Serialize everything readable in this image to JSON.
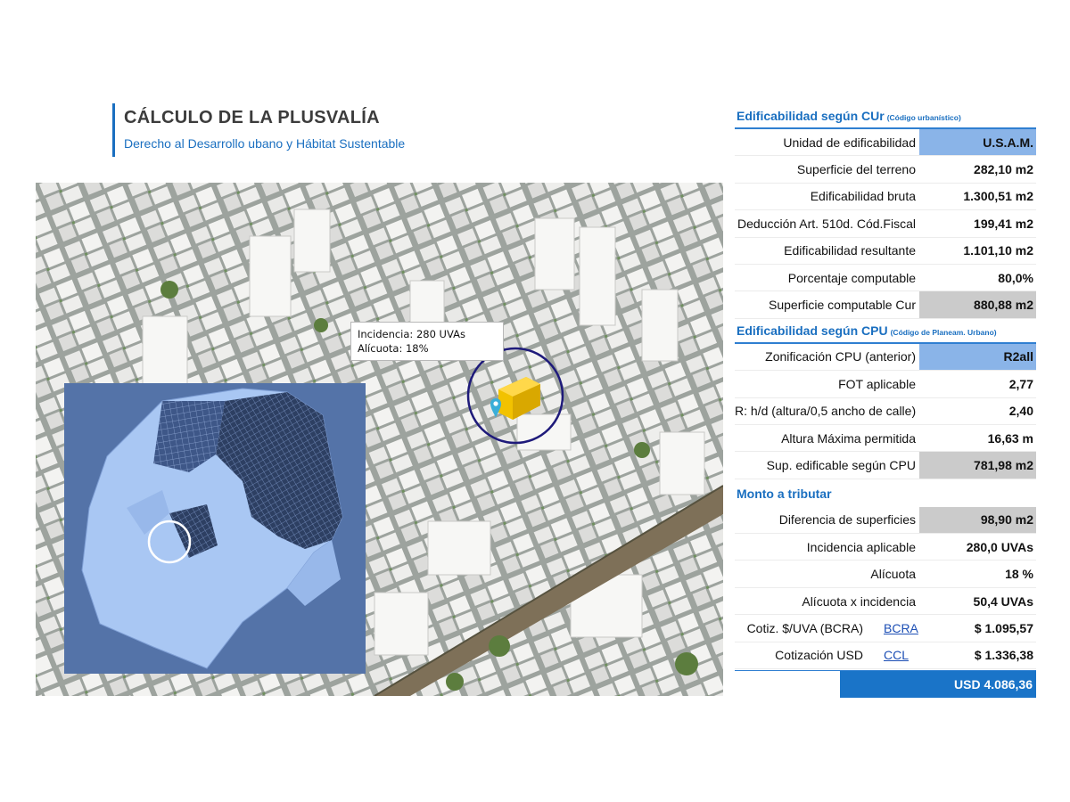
{
  "header": {
    "title": "CÁLCULO DE LA PLUSVALÍA",
    "subtitle": "Derecho al Desarrollo ubano y Hábitat Sustentable"
  },
  "map": {
    "tooltip": {
      "line1": "Incidencia: 280 UVAs",
      "line2": "Alícuota: 18%"
    },
    "pin_color": "#3aaed8",
    "building_color": "#f2c200",
    "ring_color": "#1e1a7a"
  },
  "sections": {
    "cur": {
      "title": "Edificabilidad según CUr",
      "note": "(Código urbanístico)",
      "rows": [
        {
          "label": "Unidad de edificabilidad",
          "value": "U.S.A.M."
        },
        {
          "label": "Superficie del terreno",
          "value": "282,10 m2"
        },
        {
          "label": "Edificabilidad bruta",
          "value": "1.300,51 m2"
        },
        {
          "label": "Deducción Art. 510d. Cód.Fiscal",
          "value": "199,41 m2"
        },
        {
          "label": "Edificabilidad resultante",
          "value": "1.101,10 m2"
        },
        {
          "label": "Porcentaje computable",
          "value": "80,0%"
        },
        {
          "label": "Superficie computable Cur",
          "value": "880,88 m2"
        }
      ]
    },
    "cpu": {
      "title": "Edificabilidad según CPU",
      "note": "(Código de Planeam. Urbano)",
      "rows": [
        {
          "label": "Zonificación CPU (anterior)",
          "value": "R2all"
        },
        {
          "label": "FOT aplicable",
          "value": "2,77"
        },
        {
          "label": "R: h/d (altura/0,5 ancho de calle)",
          "value": "2,40"
        },
        {
          "label": "Altura Máxima permitida",
          "value": "16,63 m"
        },
        {
          "label": "Sup. edificable según CPU",
          "value": "781,98 m2"
        }
      ]
    },
    "monto": {
      "title": "Monto a tributar",
      "rows": [
        {
          "label": "Diferencia de superficies",
          "value": "98,90 m2"
        },
        {
          "label": "Incidencia aplicable",
          "value": "280,0 UVAs"
        },
        {
          "label": "Alícuota",
          "value": "18 %"
        },
        {
          "label": "Alícuota x incidencia",
          "value": "50,4 UVAs"
        },
        {
          "label": "Cotiz. $/UVA (BCRA)",
          "link": "BCRA",
          "value": "$ 1.095,57"
        },
        {
          "label": "Cotización USD",
          "link": "CCL",
          "value": "$ 1.336,38"
        }
      ],
      "total": "USD  4.086,36"
    }
  },
  "colors": {
    "accent": "#1a6fc0",
    "highlight_blue": "#8ab4e8",
    "highlight_gray": "#cbcbcb",
    "total_bg": "#1a74c8"
  }
}
